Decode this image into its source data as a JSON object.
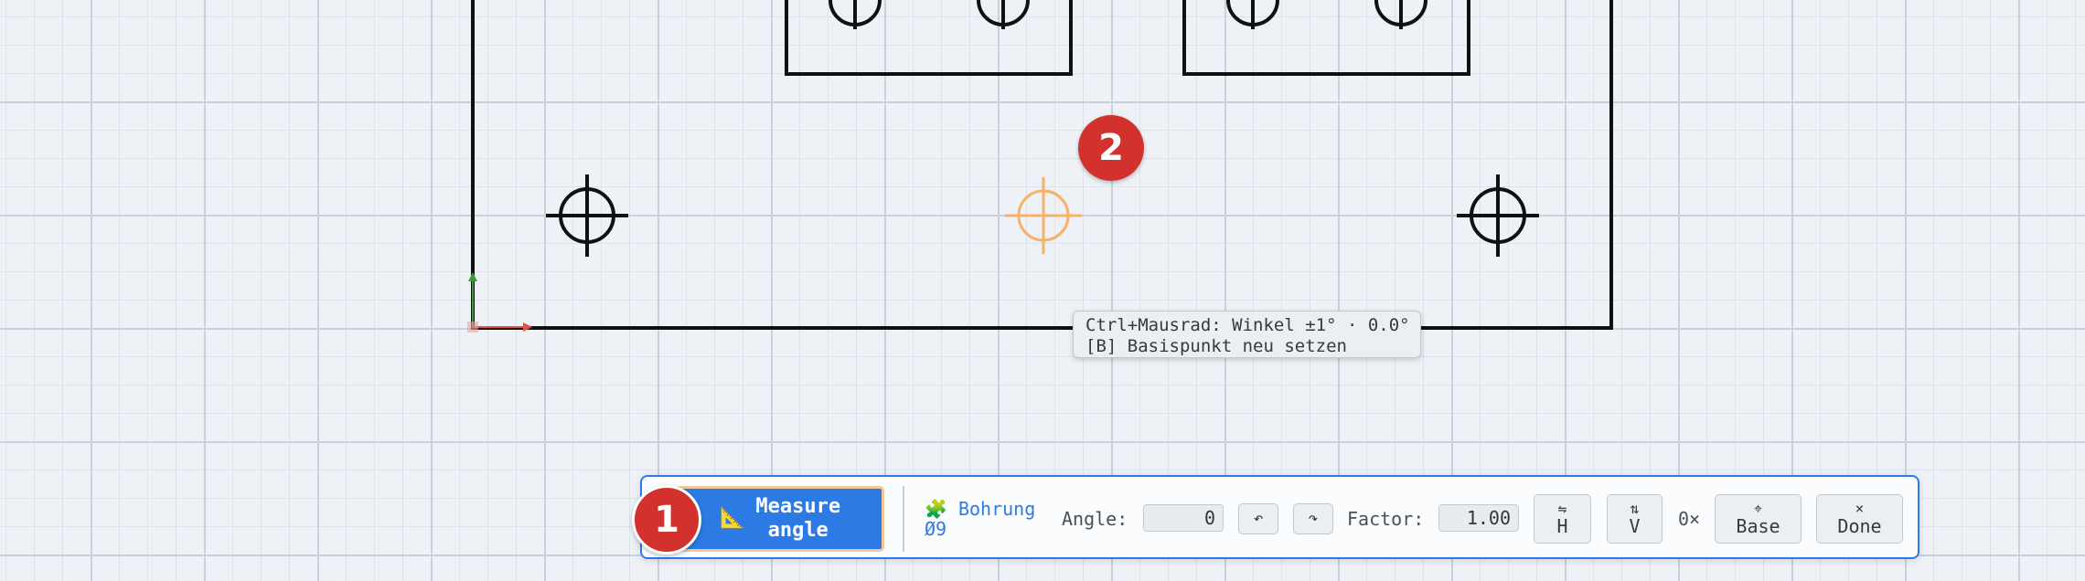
{
  "tooltip": {
    "line1": "Ctrl+Mausrad: Winkel ±1° · 0.0°",
    "line2": "[B] Basispunkt neu setzen"
  },
  "markers": {
    "first": "1",
    "second": "2"
  },
  "toolbar": {
    "measure_icon": "📐",
    "measure_label_1": "Measure",
    "measure_label_2": "angle",
    "shape_icon": "🧩",
    "shape_name": "Bohrung",
    "shape_size": "Ø9",
    "angle_label": "Angle:",
    "angle_value": "0",
    "rotate_ccw_symbol": "↶",
    "rotate_cw_symbol": "↷",
    "factor_label": "Factor:",
    "factor_value": "1.00",
    "flip_h_symbol": "⇋",
    "flip_h_label": "H",
    "flip_v_symbol": "⇅",
    "flip_v_label": "V",
    "count": "0×",
    "base_symbol": "⌖",
    "base_label": "Base",
    "done_symbol": "×",
    "done_label": "Done"
  },
  "colors": {
    "accent": "#2c7be5",
    "marker": "#d3312d",
    "preview": "#f6b16a",
    "outline": "#111111"
  }
}
